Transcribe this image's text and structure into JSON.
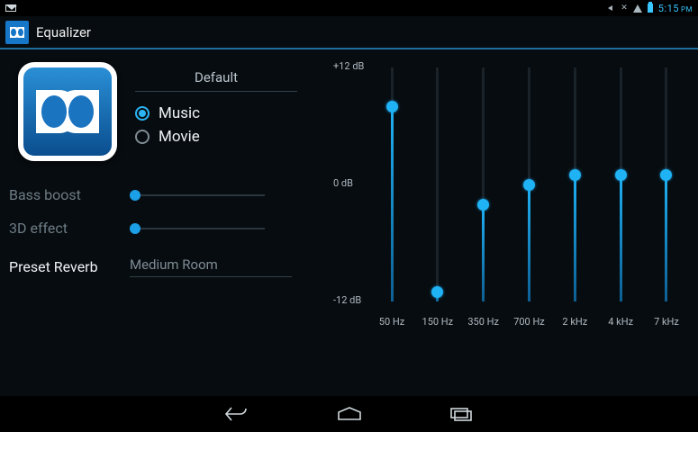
{
  "statusbar": {
    "time": "5:15",
    "ampm": "PM"
  },
  "titlebar": {
    "title": "Equalizer"
  },
  "profile": {
    "selected": "Default",
    "options": [
      {
        "label": "Music",
        "checked": true
      },
      {
        "label": "Movie",
        "checked": false
      }
    ]
  },
  "controls": {
    "bass_boost": {
      "label": "Bass boost",
      "value_pct": 4
    },
    "three_d": {
      "label": "3D effect",
      "value_pct": 4
    },
    "preset_reverb": {
      "label": "Preset Reverb",
      "value": "Medium Room"
    }
  },
  "chart_data": {
    "type": "bar",
    "title": "",
    "ylabel": "dB",
    "ylim": [
      -12,
      12
    ],
    "y_ticks": [
      "+12 dB",
      "0 dB",
      "-12 dB"
    ],
    "categories": [
      "50 Hz",
      "150 Hz",
      "350 Hz",
      "700 Hz",
      "2 kHz",
      "4 kHz",
      "7 kHz"
    ],
    "values": [
      8,
      -11,
      -2,
      0,
      1,
      1,
      1
    ]
  }
}
